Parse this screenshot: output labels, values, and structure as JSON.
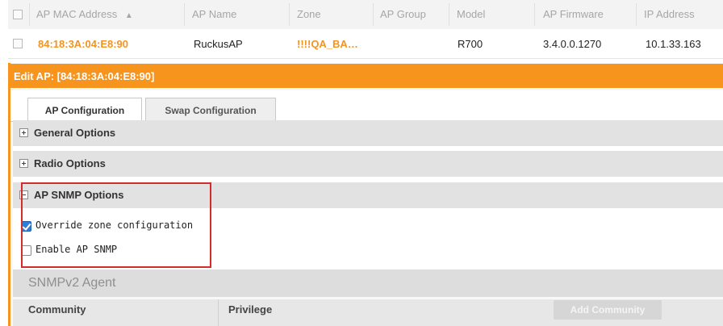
{
  "table": {
    "headers": [
      "AP MAC Address",
      "AP Name",
      "Zone",
      "AP Group",
      "Model",
      "AP Firmware",
      "IP Address"
    ],
    "sort_indicator": "▲",
    "row": {
      "mac": "84:18:3A:04:E8:90",
      "name": "RuckusAP",
      "zone": "!!!!QA_BA…",
      "group": "",
      "model": "R700",
      "firmware": "3.4.0.0.1270",
      "ip": "10.1.33.163"
    }
  },
  "edit_panel": {
    "title": "Edit AP: [84:18:3A:04:E8:90]",
    "tabs": [
      "AP Configuration",
      "Swap Configuration"
    ],
    "active_tab": "AP Configuration",
    "sections": {
      "general": "General Options",
      "radio": "Radio Options",
      "snmp": "AP SNMP Options"
    },
    "snmp_options": {
      "override_label": "Override zone configuration",
      "override_checked": true,
      "enable_label": "Enable AP SNMP",
      "enable_checked": false
    },
    "snmpv2": {
      "title": "SNMPv2 Agent",
      "columns": [
        "Community",
        "Privilege"
      ],
      "add_button": "Add Community"
    }
  },
  "colors": {
    "accent": "#f7941d",
    "highlight_box": "#d62b2b"
  }
}
